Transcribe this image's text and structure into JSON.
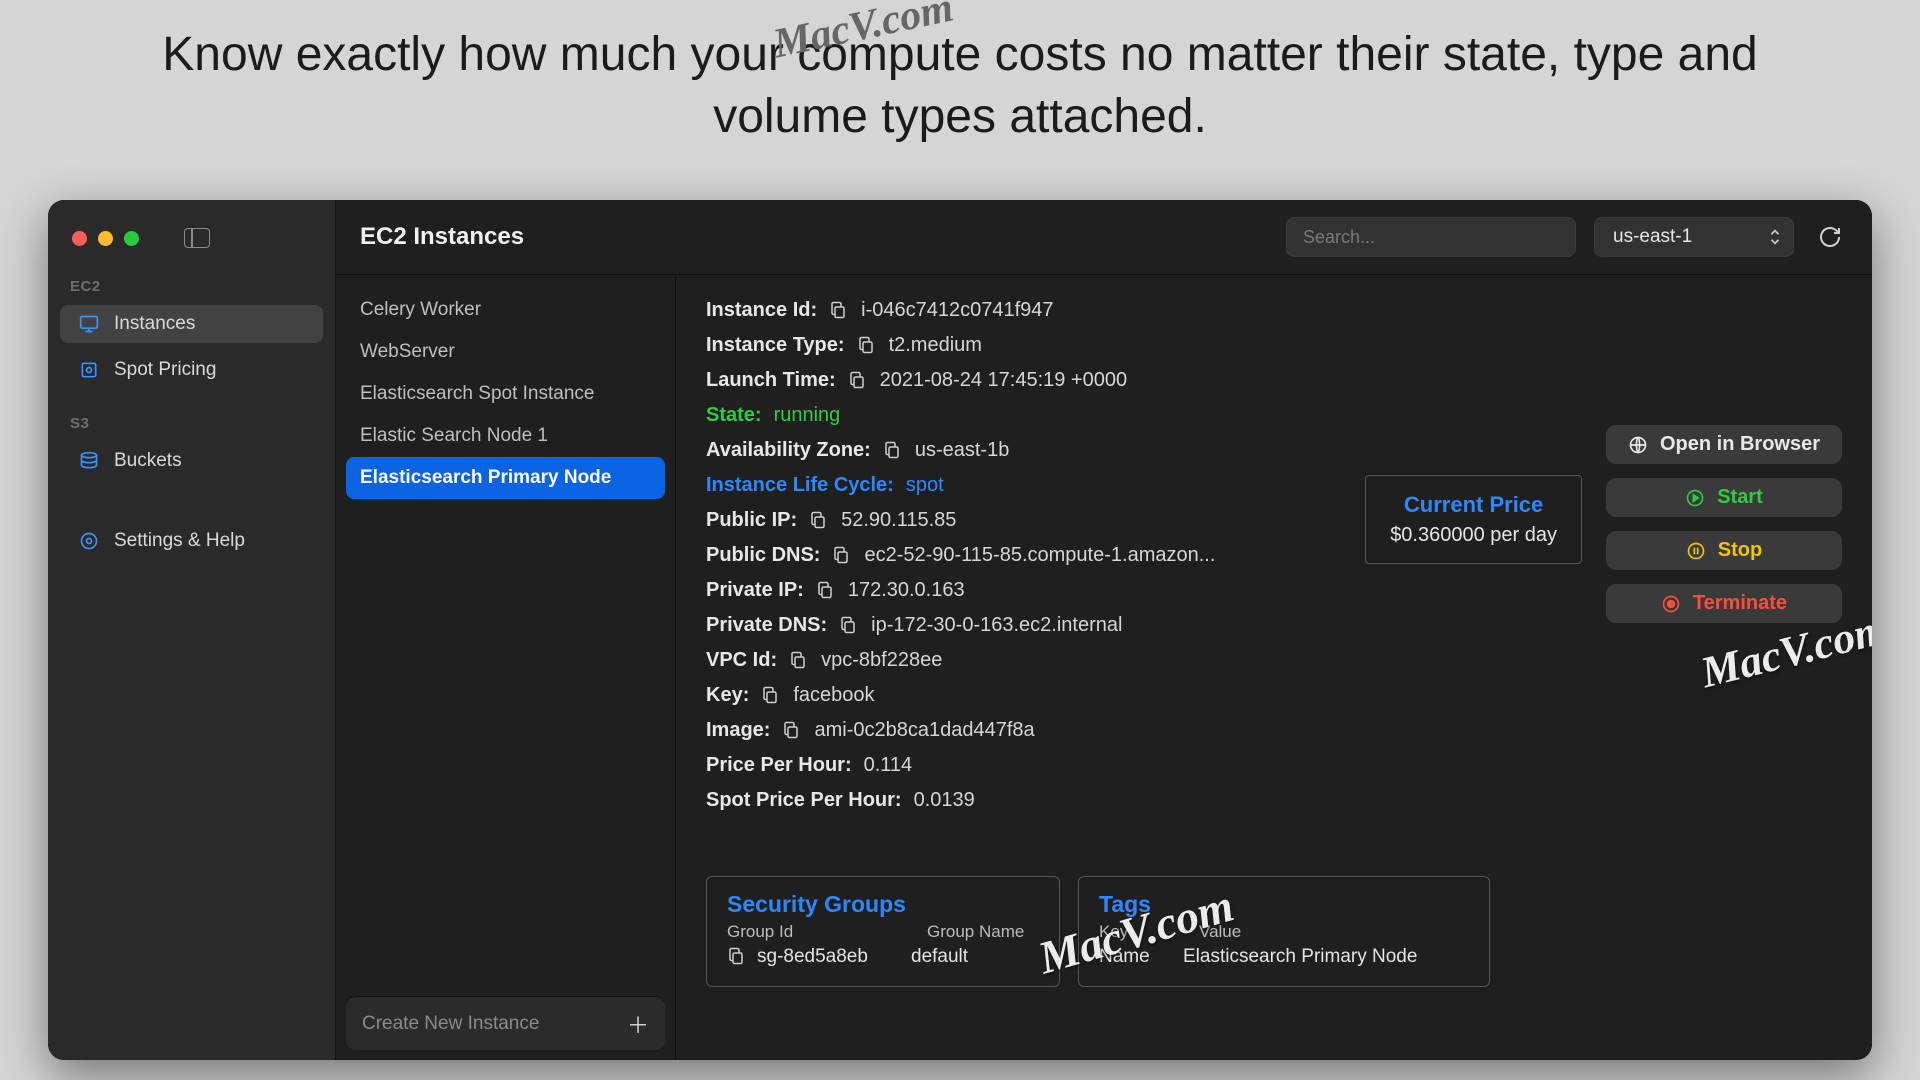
{
  "headline": "Know exactly how much your compute costs no matter their state, type and volume types attached.",
  "sidebar": {
    "sections": [
      {
        "label": "EC2",
        "items": [
          {
            "icon": "monitor",
            "label": "Instances",
            "active": true
          },
          {
            "icon": "price-tag",
            "label": "Spot Pricing",
            "active": false
          }
        ]
      },
      {
        "label": "S3",
        "items": [
          {
            "icon": "bucket",
            "label": "Buckets",
            "active": false
          }
        ]
      }
    ],
    "settings_label": "Settings & Help"
  },
  "toolbar": {
    "title": "EC2 Instances",
    "search_placeholder": "Search...",
    "region": "us-east-1"
  },
  "instances": {
    "items": [
      "Celery Worker",
      "WebServer",
      "Elasticsearch Spot Instance",
      "Elastic Search Node 1",
      "Elasticsearch Primary Node"
    ],
    "selected_index": 4,
    "create_label": "Create New Instance"
  },
  "detail": {
    "instance_id_label": "Instance Id:",
    "instance_id": "i-046c7412c0741f947",
    "instance_type_label": "Instance Type:",
    "instance_type": "t2.medium",
    "launch_time_label": "Launch Time:",
    "launch_time": "2021-08-24 17:45:19 +0000",
    "state_label": "State:",
    "state": "running",
    "az_label": "Availability Zone:",
    "az": "us-east-1b",
    "lifecycle_label": "Instance Life Cycle:",
    "lifecycle": "spot",
    "public_ip_label": "Public IP:",
    "public_ip": "52.90.115.85",
    "public_dns_label": "Public DNS:",
    "public_dns": "ec2-52-90-115-85.compute-1.amazon...",
    "private_ip_label": "Private IP:",
    "private_ip": "172.30.0.163",
    "private_dns_label": "Private DNS:",
    "private_dns": "ip-172-30-0-163.ec2.internal",
    "vpc_label": "VPC Id:",
    "vpc": "vpc-8bf228ee",
    "key_label": "Key:",
    "key": "facebook",
    "image_label": "Image:",
    "image": "ami-0c2b8ca1dad447f8a",
    "pph_label": "Price Per Hour:",
    "pph": "0.114",
    "spph_label": "Spot Price Per Hour:",
    "spph": "0.0139"
  },
  "price_card": {
    "header": "Current Price",
    "value": "$0.360000 per day"
  },
  "actions": {
    "open": "Open in Browser",
    "start": "Start",
    "stop": "Stop",
    "terminate": "Terminate"
  },
  "security_groups": {
    "header": "Security Groups",
    "col1": "Group Id",
    "col2": "Group Name",
    "rows": [
      {
        "id": "sg-8ed5a8eb",
        "name": "default"
      }
    ]
  },
  "tags": {
    "header": "Tags",
    "col1": "Key",
    "col2": "Value",
    "rows": [
      {
        "key": "Name",
        "value": "Elasticsearch Primary Node"
      }
    ]
  },
  "watermark": "MacV.com"
}
